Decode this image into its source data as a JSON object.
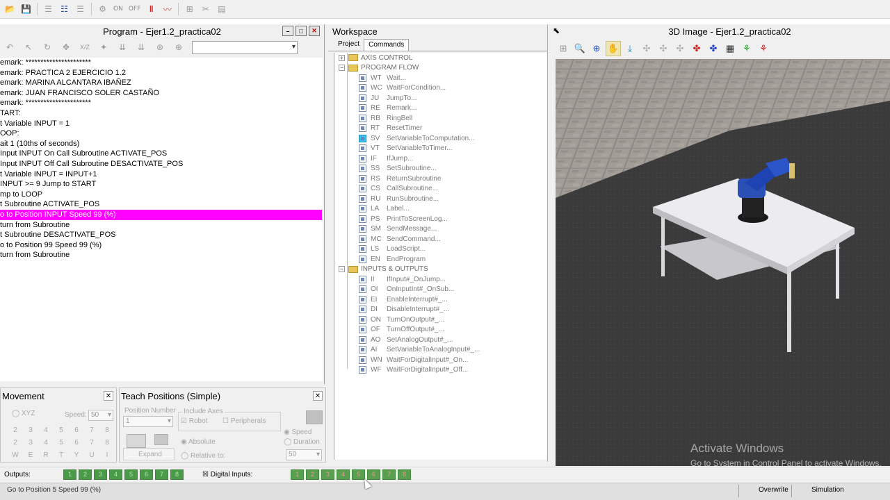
{
  "toolbar": {
    "on_label": "ON",
    "off_label": "OFF",
    "icons": [
      "open-icon",
      "save-icon",
      "outdent-icon",
      "list-icon",
      "indent-icon",
      "robot-gray-icon",
      "stop-icon",
      "graph-icon",
      "tool-icon",
      "cut-icon",
      "program-icon"
    ]
  },
  "program": {
    "title": "Program -  Ejer1.2_practica02",
    "lines": [
      "emark: **********************",
      "emark: PRACTICA 2 EJERCICIO 1.2",
      "emark: MARINA ALCANTARA IBAÑEZ",
      "emark: JUAN FRANCISCO SOLER CASTAÑO",
      "emark: **********************",
      "TART:",
      "t Variable INPUT  = 1",
      "OOP:",
      "ait 1 (10ths of seconds)",
      "Input INPUT On Call Subroutine ACTIVATE_POS",
      "Input INPUT Off Call Subroutine DESACTIVATE_POS",
      "t Variable INPUT  = INPUT+1",
      "INPUT >= 9 Jump to START",
      "mp to LOOP",
      "t Subroutine ACTIVATE_POS",
      "o to Position INPUT Speed 99 (%)",
      "turn from Subroutine",
      "t Subroutine DESACTIVATE_POS",
      "o to Position 99 Speed 99 (%)",
      "turn from Subroutine"
    ],
    "highlight_index": 15,
    "highlight_color": "#ff00ff"
  },
  "movement": {
    "title": "Movement",
    "xyz_label": "XYZ",
    "speed_label": "Speed:",
    "speed_value": "50",
    "rows": [
      [
        "2",
        "3",
        "4",
        "5",
        "6",
        "7",
        "8"
      ],
      [
        "2",
        "3",
        "4",
        "5",
        "6",
        "7",
        "8"
      ],
      [
        "W",
        "E",
        "R",
        "T",
        "Y",
        "U",
        "I"
      ]
    ]
  },
  "teach": {
    "title": "Teach Positions (Simple)",
    "position_number_label": "Position Number",
    "position_number_value": "1",
    "include_axes_label": "Include Axes",
    "robot_label": "Robot",
    "peripherals_label": "Peripherals",
    "expand_label": "Expand",
    "absolute_label": "Absolute",
    "relative_label": "Relative to:",
    "speed_label": "Speed",
    "duration_label": "Duration",
    "speed_value": "50"
  },
  "workspace": {
    "title": "Workspace",
    "tabs": [
      "Project",
      "Commands"
    ],
    "active_tab": "Commands",
    "groups": [
      {
        "label": "AXIS CONTROL",
        "expanded": false,
        "items": []
      },
      {
        "label": "PROGRAM FLOW",
        "expanded": true,
        "items": [
          {
            "code": "WT",
            "name": "Wait..."
          },
          {
            "code": "WC",
            "name": "WaitForCondition..."
          },
          {
            "code": "JU",
            "name": "JumpTo..."
          },
          {
            "code": "RE",
            "name": "Remark..."
          },
          {
            "code": "RB",
            "name": "RingBell"
          },
          {
            "code": "RT",
            "name": "ResetTimer"
          },
          {
            "code": "SV",
            "name": "SetVariableToComputation..."
          },
          {
            "code": "VT",
            "name": "SetVariableToTimer..."
          },
          {
            "code": "IF",
            "name": "IfJump..."
          },
          {
            "code": "SS",
            "name": "SetSubroutine..."
          },
          {
            "code": "RS",
            "name": "ReturnSubroutine"
          },
          {
            "code": "CS",
            "name": "CallSubroutine..."
          },
          {
            "code": "RU",
            "name": "RunSubroutine..."
          },
          {
            "code": "LA",
            "name": "Label..."
          },
          {
            "code": "PS",
            "name": "PrintToScreenLog..."
          },
          {
            "code": "SM",
            "name": "SendMessage..."
          },
          {
            "code": "MC",
            "name": "SendCommand..."
          },
          {
            "code": "LS",
            "name": "LoadScript..."
          },
          {
            "code": "EN",
            "name": "EndProgram"
          }
        ]
      },
      {
        "label": "INPUTS & OUTPUTS",
        "expanded": true,
        "items": [
          {
            "code": "II",
            "name": "IfInput#_OnJump..."
          },
          {
            "code": "OI",
            "name": "OnInputInt#_OnSub..."
          },
          {
            "code": "EI",
            "name": "EnableInterrupt#_..."
          },
          {
            "code": "DI",
            "name": "DisableInterrupt#_..."
          },
          {
            "code": "ON",
            "name": "TurnOnOutput#_..."
          },
          {
            "code": "OF",
            "name": "TurnOffOutput#_..."
          },
          {
            "code": "AO",
            "name": "SetAnalogOutput#_..."
          },
          {
            "code": "AI",
            "name": "SetVariableToAnalogInput#_..."
          },
          {
            "code": "WN",
            "name": "WaitForDigitalInput#_On..."
          },
          {
            "code": "WF",
            "name": "WaitForDigitalInput#_Off..."
          }
        ]
      }
    ]
  },
  "view3d": {
    "title": "3D Image -  Ejer1.2_practica02",
    "icons": [
      "robot-view-icon",
      "zoom-icon",
      "zoom-fit-icon",
      "hand-pan-icon",
      "rotate-view-icon",
      "axis-a-icon",
      "axis-b-icon",
      "axis-c-icon",
      "robot-red-icon",
      "robot-blue-icon",
      "grid-icon",
      "tree-green-icon",
      "tree-red-icon"
    ]
  },
  "watermark": {
    "title": "Activate Windows",
    "subtitle": "Go to System in Control Panel to activate Windows."
  },
  "io": {
    "outputs_label": "Outputs:",
    "outputs": [
      "1",
      "2",
      "3",
      "4",
      "5",
      "6",
      "7",
      "8"
    ],
    "inputs_label": "Digital Inputs:",
    "inputs": [
      "1",
      "2",
      "3",
      "4",
      "5",
      "6",
      "7",
      "8"
    ],
    "active_input": "5"
  },
  "status": {
    "text": "Go to Position 5 Speed 99 (%)",
    "overwrite_label": "Overwrite",
    "mode_label": "Simulation"
  }
}
